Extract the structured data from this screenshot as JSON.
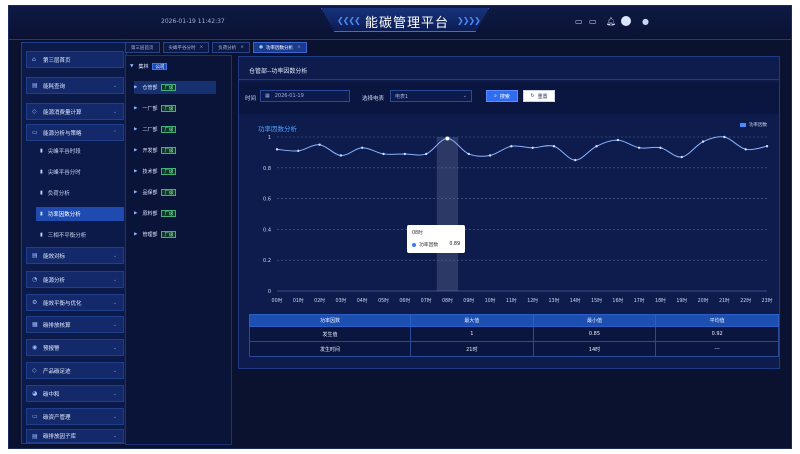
{
  "header": {
    "datetime": "2026-01-19 11:42:37",
    "title": "能碳管理平台",
    "chevrons_left": "❮❮❮❮",
    "chevrons_right": "❯❯❯❯",
    "icons": [
      "monitor-icon",
      "screen-icon",
      "bell-icon",
      "avatar-icon",
      "user-icon"
    ]
  },
  "sidebar": {
    "items": [
      {
        "label": "第三层首页",
        "icon": "home-icon",
        "arrow": false
      },
      {
        "label": "能耗查询",
        "icon": "chart-icon",
        "arrow": true
      },
      {
        "label": "能源消费量计算",
        "icon": "calc-icon",
        "arrow": true
      },
      {
        "label": "能源分析与策略",
        "icon": "analysis-icon",
        "arrow": true
      },
      {
        "label": "能效对标",
        "icon": "compare-icon",
        "arrow": true
      },
      {
        "label": "能源分析",
        "icon": "pie-icon",
        "arrow": true
      },
      {
        "label": "能效平衡与优化",
        "icon": "balance-icon",
        "arrow": true
      },
      {
        "label": "碳排放核算",
        "icon": "carbon-icon",
        "arrow": true
      },
      {
        "label": "预报警",
        "icon": "alarm-icon",
        "arrow": true
      },
      {
        "label": "产品碳足迹",
        "icon": "footprint-icon",
        "arrow": true
      },
      {
        "label": "碳中和",
        "icon": "neutral-icon",
        "arrow": true
      },
      {
        "label": "碳资产管理",
        "icon": "asset-icon",
        "arrow": true
      },
      {
        "label": "碳排放因子库",
        "icon": "factor-icon",
        "arrow": true
      }
    ],
    "subitems": [
      {
        "label": "尖峰平谷时段"
      },
      {
        "label": "尖峰平谷分时"
      },
      {
        "label": "负荷分析"
      },
      {
        "label": "功率因数分析",
        "active": true
      },
      {
        "label": "三相不平衡分析"
      }
    ]
  },
  "tabs": [
    {
      "label": "第三层首页",
      "closable": false
    },
    {
      "label": "尖峰平谷分时",
      "closable": true
    },
    {
      "label": "负荷分析",
      "closable": true
    },
    {
      "label": "功率因数分析",
      "closable": true,
      "active": true
    }
  ],
  "tree": {
    "root": {
      "label": "集林",
      "badge": "公司"
    },
    "children": [
      {
        "label": "仓管部",
        "badge": "厂级",
        "selected": true
      },
      {
        "label": "一厂部",
        "badge": "厂级"
      },
      {
        "label": "二厂部",
        "badge": "厂级"
      },
      {
        "label": "开发部",
        "badge": "厂级"
      },
      {
        "label": "技术部",
        "badge": "厂级"
      },
      {
        "label": "品保部",
        "badge": "厂级"
      },
      {
        "label": "原料部",
        "badge": "厂级"
      },
      {
        "label": "管理部",
        "badge": "厂级"
      }
    ]
  },
  "panel": {
    "title": "仓管部--功率因数分析"
  },
  "filter": {
    "time_label": "时间",
    "date_value": "2026-01-19",
    "meter_label": "选择电表",
    "meter_value": "电表1",
    "search_label": "搜索",
    "reset_label": "重置"
  },
  "chart_data": {
    "type": "line",
    "title": "功率因数分析",
    "legend": [
      "功率因数"
    ],
    "legend_position": "top-right",
    "categories": [
      "00时",
      "01时",
      "02时",
      "03时",
      "04时",
      "05时",
      "06时",
      "07时",
      "08时",
      "09时",
      "10时",
      "11时",
      "12时",
      "13时",
      "14时",
      "15时",
      "16时",
      "17时",
      "18时",
      "19时",
      "20时",
      "21时",
      "22时",
      "23时"
    ],
    "series": [
      {
        "name": "功率因数",
        "values": [
          0.92,
          0.91,
          0.95,
          0.88,
          0.93,
          0.89,
          0.89,
          0.89,
          0.99,
          0.89,
          0.88,
          0.94,
          0.93,
          0.94,
          0.85,
          0.94,
          0.98,
          0.93,
          0.93,
          0.87,
          0.97,
          1.0,
          0.92,
          0.94
        ]
      }
    ],
    "ylim": [
      0,
      1
    ],
    "yticks": [
      0,
      0.2,
      0.4,
      0.6,
      0.8,
      1
    ],
    "grid": true,
    "highlight_index": 8,
    "tooltip": {
      "title": "08时",
      "name": "功率因数",
      "value": "0.89"
    }
  },
  "stats_table": {
    "headers": [
      "功率因数",
      "最大值",
      "最小值",
      "平均值"
    ],
    "rows": [
      [
        "发生值",
        "1",
        "0.85",
        "0.92"
      ],
      [
        "发生时间",
        "21时",
        "14时",
        "---"
      ]
    ]
  },
  "colors": {
    "accent": "#4a8cff",
    "line": "#8ab4ff",
    "header_bg": "#0e1a44",
    "table_header": "#1c4fb0"
  }
}
